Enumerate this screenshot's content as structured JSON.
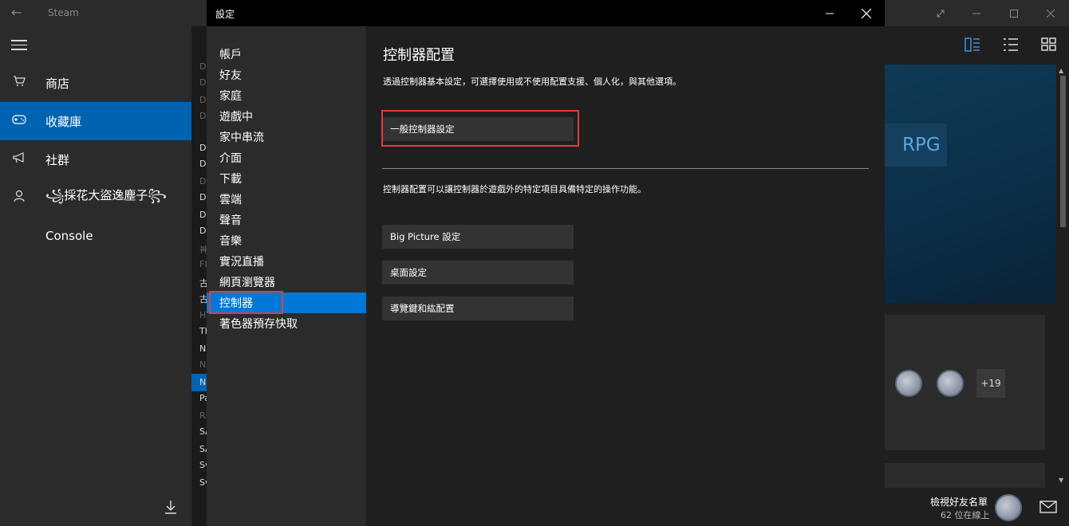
{
  "app": {
    "title": "Steam"
  },
  "nav": {
    "items": [
      {
        "label": "商店",
        "icon": "cart-icon"
      },
      {
        "label": "收藏庫",
        "icon": "gamepad-icon"
      },
      {
        "label": "社群",
        "icon": "megaphone-icon"
      },
      {
        "label": "꧁採花大盜逸塵子꧂",
        "icon": "person-icon"
      },
      {
        "label": "Console",
        "icon": ""
      }
    ],
    "active_index": 1
  },
  "game_list_fragments": [
    "D",
    "D",
    "D",
    "D",
    "D",
    "D",
    "D",
    "D",
    "D",
    "D",
    "神",
    "FI",
    "古",
    "古",
    "H",
    "Th",
    "N",
    "N",
    "N",
    "Pa",
    "Ri",
    "SA",
    "SA",
    "Sv",
    "Sv"
  ],
  "dialog": {
    "title": "設定",
    "categories": [
      "帳戶",
      "好友",
      "家庭",
      "遊戲中",
      "家中串流",
      "介面",
      "下載",
      "雲端",
      "聲音",
      "音樂",
      "實況直播",
      "網頁瀏覽器",
      "控制器",
      "著色器預存快取"
    ],
    "active_category_index": 12,
    "main": {
      "heading": "控制器配置",
      "description": "透過控制器基本設定，可選擇使用或不使用配置支援、個人化，與其他選項。",
      "general_button": "一般控制器設定",
      "section_description": "控制器配置可以讓控制器於遊戲外的特定項目具備特定的操作功能。",
      "buttons": [
        "Big Picture 設定",
        "桌面設定",
        "導覽鍵和紘配置"
      ]
    }
  },
  "right_panel": {
    "genre_label": "RPG",
    "friends_more": "+19",
    "view_friends": "檢視好友名單",
    "online_count": "62 位在線上"
  },
  "colors": {
    "accent": "#0063b1",
    "highlight_box": "#e43b3b",
    "active_category": "#0078d7"
  }
}
